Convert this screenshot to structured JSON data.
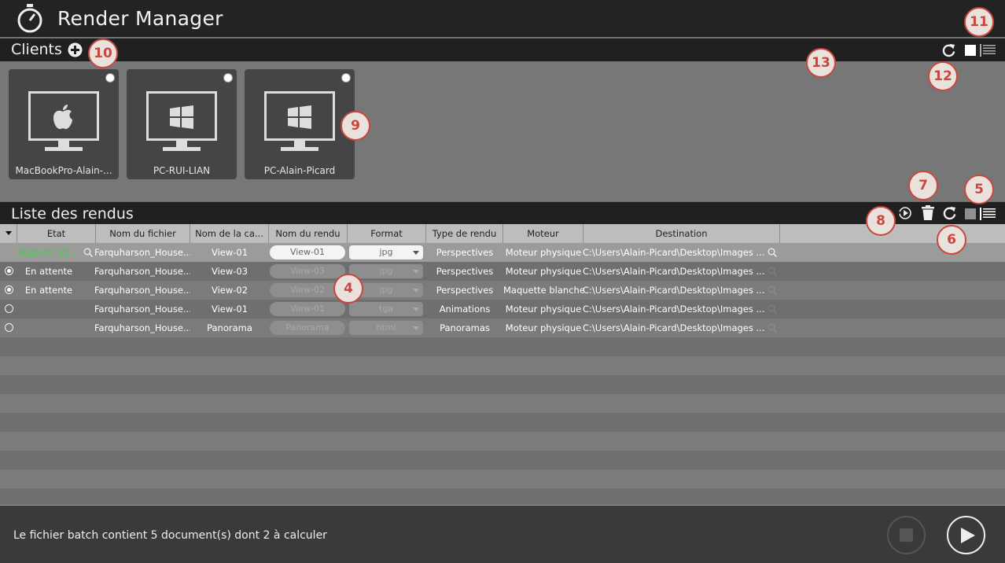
{
  "app": {
    "title": "Render Manager"
  },
  "clients": {
    "section_title": "Clients",
    "items": [
      {
        "name": "MacBookPro-Alain-...",
        "os_icon": "apple-icon"
      },
      {
        "name": "PC-RUI-LIAN",
        "os_icon": "windows-icon"
      },
      {
        "name": "PC-Alain-Picard",
        "os_icon": "windows-icon"
      }
    ]
  },
  "renders": {
    "section_title": "Liste des rendus",
    "columns": [
      "Etat",
      "Nom du fichier",
      "Nom de la ca...",
      "Nom du rendu",
      "Format",
      "Type de rendu",
      "Moteur",
      "Destination"
    ],
    "rows": [
      {
        "etat": "2016-07-25 ...",
        "fichier": "Farquharson_House...",
        "camera": "View-01",
        "rendu": "View-01",
        "format": "jpg",
        "type": "Perspectives",
        "moteur": "Moteur physique",
        "destination": "C:\\Users\\Alain-Picard\\Desktop\\Images ..."
      },
      {
        "etat": "En attente",
        "fichier": "Farquharson_House...",
        "camera": "View-03",
        "rendu": "View-03",
        "format": "jpg",
        "type": "Perspectives",
        "moteur": "Moteur physique",
        "destination": "C:\\Users\\Alain-Picard\\Desktop\\Images ..."
      },
      {
        "etat": "En attente",
        "fichier": "Farquharson_House...",
        "camera": "View-02",
        "rendu": "View-02",
        "format": "jpg",
        "type": "Perspectives",
        "moteur": "Maquette blanche",
        "destination": "C:\\Users\\Alain-Picard\\Desktop\\Images ..."
      },
      {
        "etat": "",
        "fichier": "Farquharson_House...",
        "camera": "View-01",
        "rendu": "View-01",
        "format": "tga",
        "type": "Animations",
        "moteur": "Moteur physique",
        "destination": "C:\\Users\\Alain-Picard\\Desktop\\Images ..."
      },
      {
        "etat": "",
        "fichier": "Farquharson_House...",
        "camera": "Panorama",
        "rendu": "Panorama",
        "format": "html",
        "type": "Panoramas",
        "moteur": "Moteur physique",
        "destination": "C:\\Users\\Alain-Picard\\Desktop\\Images ..."
      }
    ]
  },
  "footer": {
    "status": "Le fichier batch contient 5 document(s) dont 2 à calculer"
  },
  "callouts": {
    "c4": "4",
    "c5": "5",
    "c6": "6",
    "c7": "7",
    "c8": "8",
    "c9": "9",
    "c10": "10",
    "c11": "11",
    "c12": "12",
    "c13": "13"
  },
  "colors": {
    "done_status": "#3fd13f",
    "callout_border": "#c9473f",
    "title_bg": "#232323",
    "panel_bg": "#7a7a7a"
  }
}
